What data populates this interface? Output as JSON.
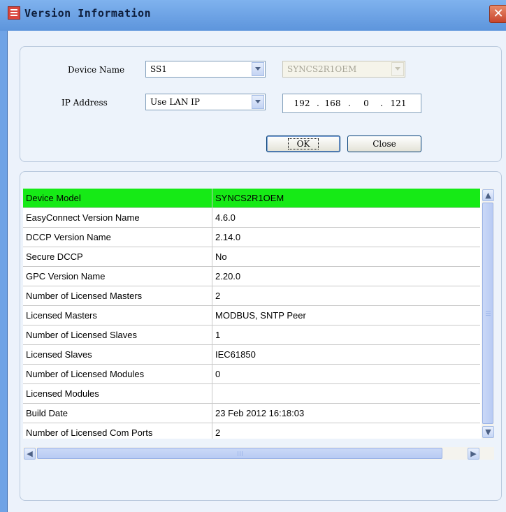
{
  "window": {
    "title": "Version Information"
  },
  "form": {
    "device_name_label": "Device Name",
    "device_name_value": "SS1",
    "device_model_value": "SYNCS2R1OEM",
    "ip_label": "IP Address",
    "ip_mode_value": "Use LAN IP",
    "ip_octets": [
      "192",
      "168",
      "0",
      "121"
    ],
    "ok_label": "OK",
    "close_label": "Close"
  },
  "table": {
    "rows": [
      {
        "name": "Device Model",
        "value": "SYNCS2R1OEM",
        "selected": true
      },
      {
        "name": "EasyConnect Version Name",
        "value": "4.6.0"
      },
      {
        "name": "DCCP Version Name",
        "value": "2.14.0"
      },
      {
        "name": "Secure DCCP",
        "value": "No"
      },
      {
        "name": "GPC Version Name",
        "value": "2.20.0"
      },
      {
        "name": "Number of Licensed Masters",
        "value": "2"
      },
      {
        "name": "Licensed Masters",
        "value": "MODBUS, SNTP Peer"
      },
      {
        "name": "Number of Licensed Slaves",
        "value": "1"
      },
      {
        "name": "Licensed Slaves",
        "value": "IEC61850"
      },
      {
        "name": "Number of Licensed Modules",
        "value": "0"
      },
      {
        "name": "Licensed Modules",
        "value": ""
      },
      {
        "name": "Build Date",
        "value": "23 Feb 2012 16:18:03"
      },
      {
        "name": "Number of Licensed Com Ports",
        "value": "2"
      }
    ]
  },
  "colors": {
    "selected_row": "#16ea16",
    "titlebar": "#6fa3e6"
  },
  "icons": {
    "title": "list-icon",
    "close": "close-icon"
  }
}
